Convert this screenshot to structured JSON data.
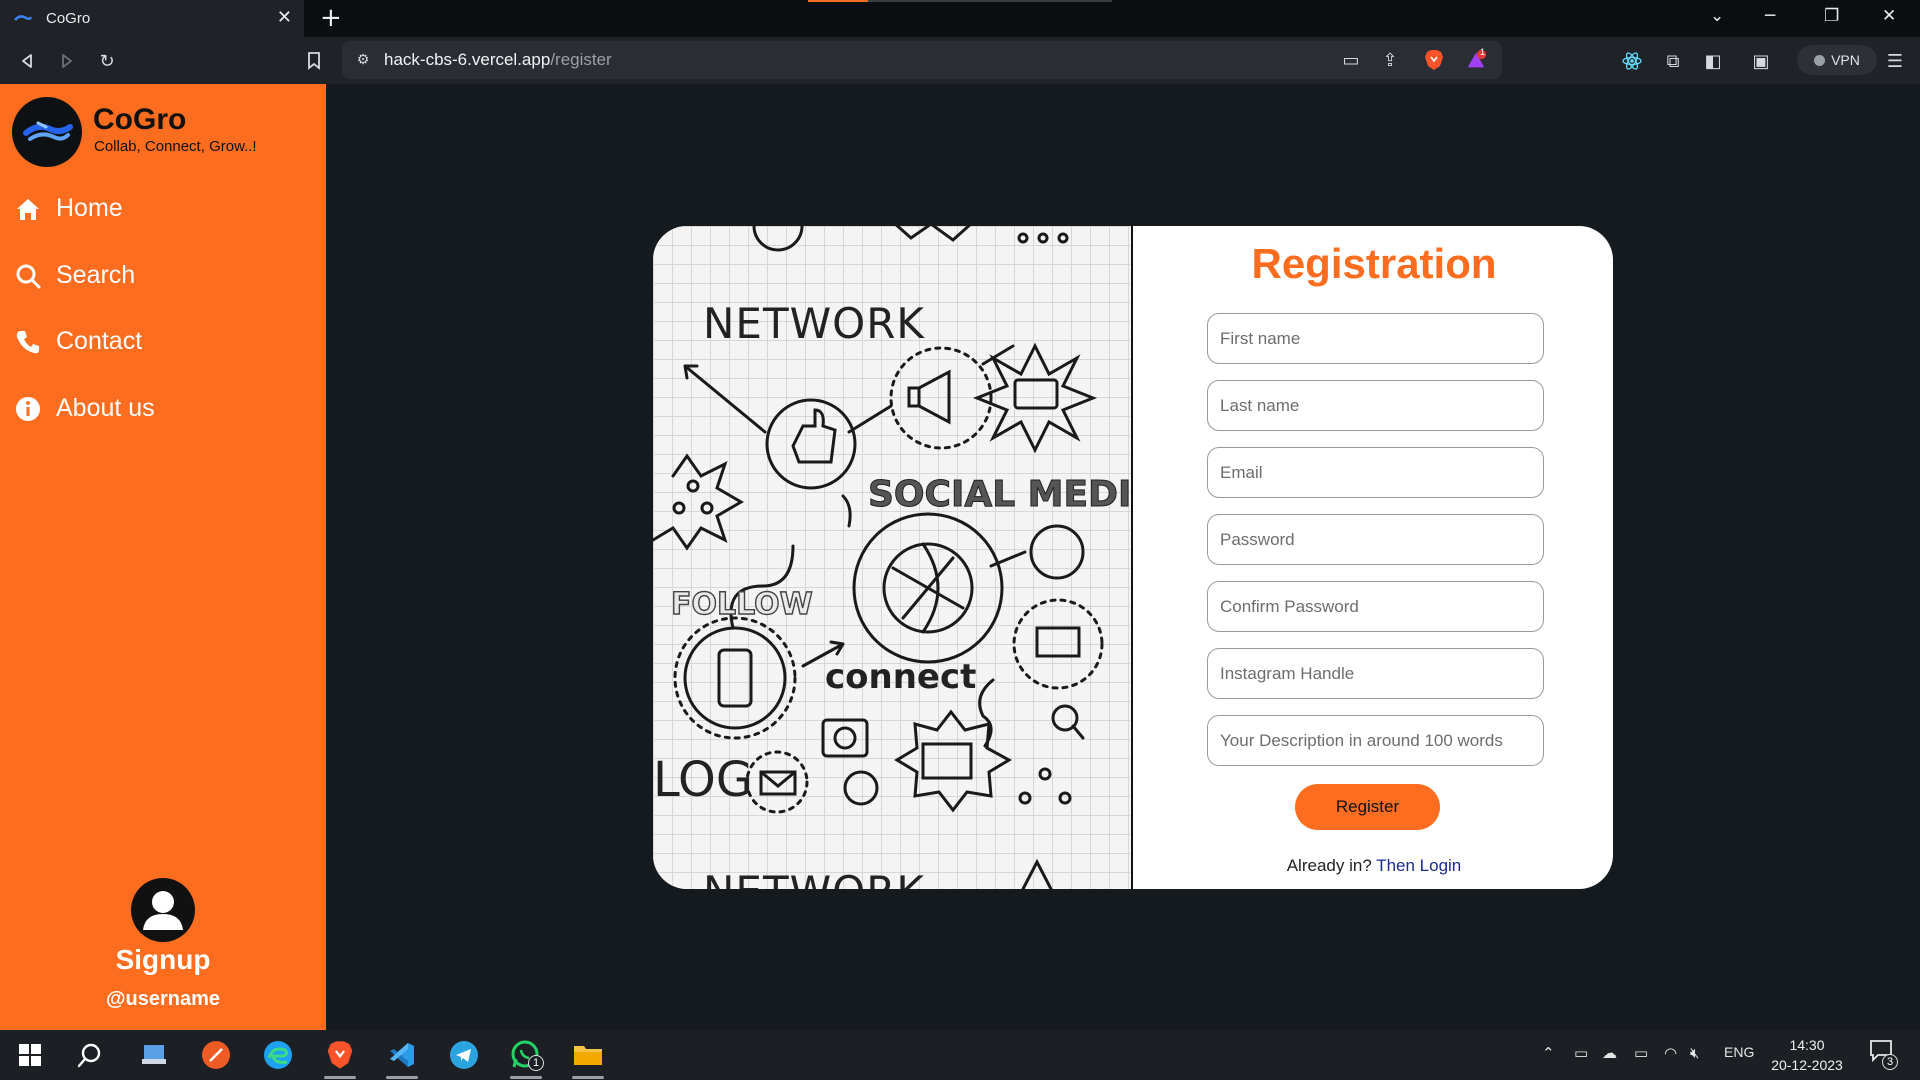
{
  "browser": {
    "tab_title": "CoGro",
    "url_host": "hack-cbs-6.vercel.app",
    "url_path": "/register",
    "vpn_label": "VPN",
    "notification_badge": "1"
  },
  "sidebar": {
    "brand_name": "CoGro",
    "brand_tagline": "Collab, Connect, Grow..!",
    "items": [
      {
        "label": "Home",
        "icon": "home-icon"
      },
      {
        "label": "Search",
        "icon": "search-icon"
      },
      {
        "label": "Contact",
        "icon": "phone-icon"
      },
      {
        "label": "About us",
        "icon": "info-icon"
      }
    ],
    "signup_label": "Signup",
    "username": "@username"
  },
  "illustration": {
    "words": [
      "NETWORK",
      "SOCIAL MEDIA",
      "FOLLOW",
      "connect",
      "LOG",
      "NETWORK"
    ]
  },
  "form": {
    "title": "Registration",
    "fields": [
      {
        "placeholder": "First name",
        "value": ""
      },
      {
        "placeholder": "Last name",
        "value": ""
      },
      {
        "placeholder": "Email",
        "value": ""
      },
      {
        "placeholder": "Password",
        "value": ""
      },
      {
        "placeholder": "Confirm Password",
        "value": ""
      },
      {
        "placeholder": "Instagram Handle",
        "value": ""
      },
      {
        "placeholder": "Your Description in around 100 words",
        "value": ""
      }
    ],
    "register_label": "Register",
    "login_prompt": "Already in? ",
    "login_link": "Then Login"
  },
  "taskbar": {
    "language": "ENG",
    "time": "14:30",
    "date": "20-12-2023",
    "whatsapp_badge": "1",
    "notification_count": "3"
  },
  "colors": {
    "accent": "#fd6d1f",
    "page_bg": "#141a1d",
    "link": "#1b2a8f"
  }
}
